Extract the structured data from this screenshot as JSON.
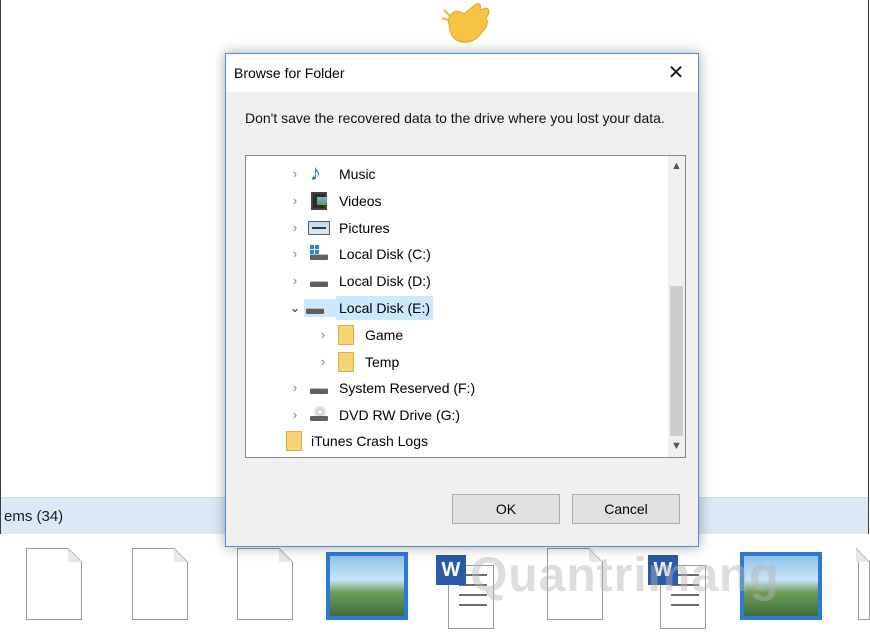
{
  "background": {
    "items_label": "ems (34)",
    "watermark": "Quantrimang"
  },
  "dialog": {
    "title": "Browse for Folder",
    "close_label": "✕",
    "message": "Don't save the recovered data to the drive where you lost your data.",
    "tree": [
      {
        "label": "Music",
        "icon": "music-icon",
        "expanded": false
      },
      {
        "label": "Videos",
        "icon": "videos-icon",
        "expanded": false
      },
      {
        "label": "Pictures",
        "icon": "pictures-icon",
        "expanded": false
      },
      {
        "label": "Local Disk (C:)",
        "icon": "windows-disk-icon",
        "expanded": false
      },
      {
        "label": "Local Disk (D:)",
        "icon": "disk-icon",
        "expanded": false
      },
      {
        "label": "Local Disk (E:)",
        "icon": "disk-icon",
        "expanded": true,
        "selected": true
      },
      {
        "label": "Game",
        "icon": "folder-icon",
        "expanded": false
      },
      {
        "label": "Temp",
        "icon": "folder-icon",
        "expanded": false
      },
      {
        "label": "System Reserved (F:)",
        "icon": "disk-icon",
        "expanded": false
      },
      {
        "label": "DVD RW Drive (G:)",
        "icon": "dvd-drive-icon",
        "expanded": false
      },
      {
        "label": "iTunes Crash Logs",
        "icon": "folder-icon"
      }
    ],
    "ok_label": "OK",
    "cancel_label": "Cancel"
  },
  "colors": {
    "selection": "#cce8ff",
    "dialog_border": "#4a90d9",
    "items_bar": "#dbe8f6"
  }
}
